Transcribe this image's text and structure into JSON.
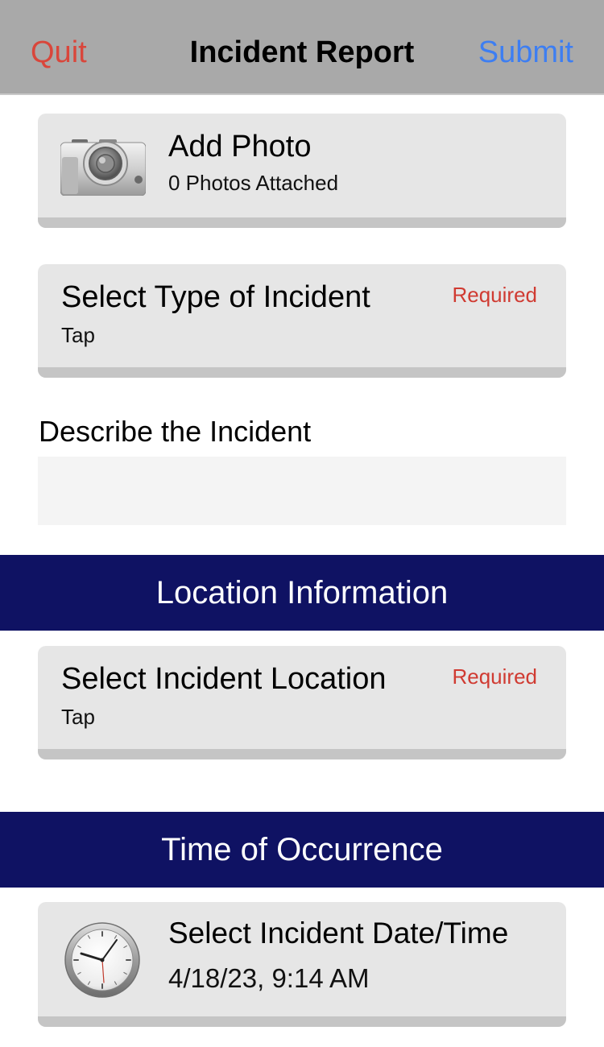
{
  "navbar": {
    "quit_label": "Quit",
    "title": "Incident Report",
    "submit_label": "Submit"
  },
  "photo": {
    "title": "Add Photo",
    "subtitle": "0 Photos Attached",
    "icon": "camera-icon"
  },
  "incident_type": {
    "title": "Select Type of Incident",
    "subtitle": "Tap",
    "required_label": "Required"
  },
  "description": {
    "label": "Describe the Incident",
    "value": "",
    "placeholder": ""
  },
  "location_section": {
    "header": "Location Information",
    "location": {
      "title": "Select Incident Location",
      "subtitle": "Tap",
      "required_label": "Required"
    }
  },
  "time_section": {
    "header": "Time of Occurrence",
    "datetime": {
      "title": "Select Incident Date/Time",
      "value": "4/18/23, 9:14 AM",
      "icon": "clock-icon"
    }
  },
  "colors": {
    "quit": "#d9463b",
    "submit": "#3d7ef2",
    "required": "#d03b32",
    "section_header_bg": "#0f1263",
    "navbar_bg": "#a9a9a9",
    "card_bg": "#e6e6e6"
  }
}
